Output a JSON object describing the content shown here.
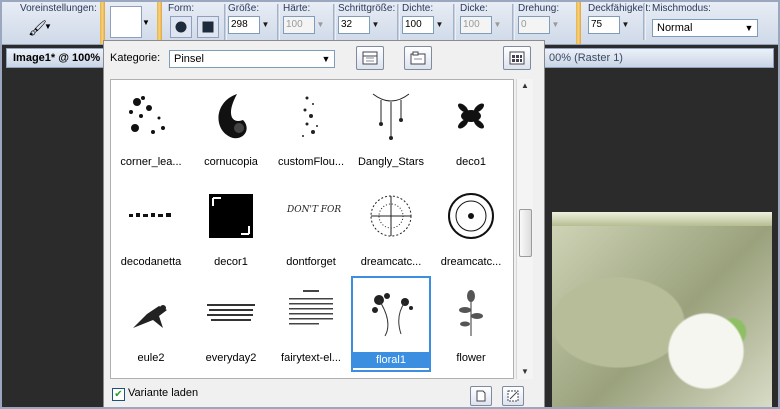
{
  "toolbar": {
    "presets_label": "Voreinstellungen:",
    "form_label": "Form:",
    "size_label": "Größe:",
    "size_value": "298",
    "hardness_label": "Härte:",
    "hardness_value": "100",
    "step_label": "Schrittgröße:",
    "step_value": "32",
    "density_label": "Dichte:",
    "density_value": "100",
    "thickness_label": "Dicke:",
    "thickness_value": "100",
    "rotation_label": "Drehung:",
    "rotation_value": "0",
    "opacity_label": "Deckfähigkeit:",
    "opacity_value": "75",
    "blendmode_label": "Mischmodus:",
    "blendmode_value": "Normal"
  },
  "windows": {
    "left_title": "Image1* @ 100%",
    "right_title": "00% (Raster 1)"
  },
  "picker": {
    "category_label": "Kategorie:",
    "category_value": "Pinsel",
    "brushes": [
      "corner_lea...",
      "cornucopia",
      "customFlou...",
      "Dangly_Stars",
      "deco1",
      "decodanetta",
      "decor1",
      "dontforget",
      "dreamcatc...",
      "dreamcatc...",
      "eule2",
      "everyday2",
      "fairytext-el...",
      "floral1",
      "flower"
    ],
    "selected": "floral1",
    "load_variant_label": "Variante laden",
    "dontforget_text": "DON'T FORGET"
  },
  "colors": {
    "selection": "#3c8fe0",
    "toolbar_bg": "#d8e1ee",
    "separator_gold": "#e7b247"
  }
}
